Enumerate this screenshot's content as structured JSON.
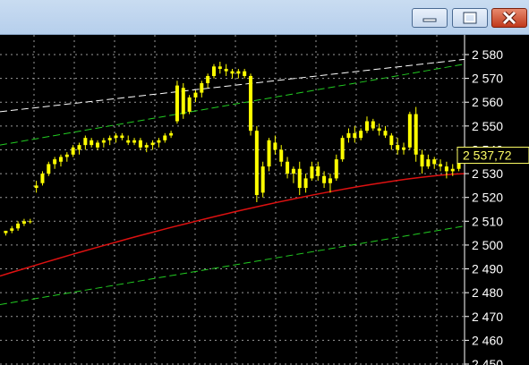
{
  "window": {
    "buttons": {
      "minimize_icon": "minimize-icon",
      "maximize_icon": "maximize-icon",
      "close_icon": "close-icon"
    }
  },
  "chart_data": {
    "type": "candlestick",
    "yaxis": {
      "ylim": [
        2447,
        2585
      ],
      "ticks": [
        2580,
        2570,
        2560,
        2550,
        2540,
        2530,
        2520,
        2510,
        2500,
        2490,
        2480,
        2470,
        2460,
        2450
      ],
      "tick_labels": [
        "2 580",
        "2 570",
        "2 560",
        "2 550",
        "2 540",
        "2 530",
        "2 520",
        "2 510",
        "2 500",
        "2 490",
        "2 480",
        "2 470",
        "2 460",
        "2 450"
      ]
    },
    "last_price_label": "2 537,72",
    "last_price": 2537.72,
    "grid": true,
    "candles": [
      [
        2505,
        2506,
        2504,
        2506
      ],
      [
        2506,
        2508,
        2505,
        2507
      ],
      [
        2507,
        2510,
        2506,
        2509
      ],
      [
        2509,
        2511,
        2508,
        2510
      ],
      [
        2510,
        2511,
        2509,
        2510
      ],
      [
        2524,
        2527,
        2522,
        2525
      ],
      [
        2526,
        2531,
        2525,
        2530
      ],
      [
        2530,
        2535,
        2529,
        2534
      ],
      [
        2534,
        2537,
        2532,
        2536
      ],
      [
        2535,
        2538,
        2533,
        2537
      ],
      [
        2537,
        2539,
        2535,
        2538
      ],
      [
        2538,
        2542,
        2537,
        2541
      ],
      [
        2540,
        2543,
        2538,
        2542
      ],
      [
        2542,
        2546,
        2540,
        2545
      ],
      [
        2544,
        2545,
        2541,
        2542
      ],
      [
        2541,
        2544,
        2540,
        2543
      ],
      [
        2543,
        2545,
        2541,
        2544
      ],
      [
        2544,
        2546,
        2542,
        2545
      ],
      [
        2545,
        2547,
        2543,
        2546
      ],
      [
        2546,
        2547,
        2544,
        2545
      ],
      [
        2544,
        2546,
        2542,
        2543
      ],
      [
        2543,
        2545,
        2542,
        2544
      ],
      [
        2544,
        2545,
        2540,
        2541
      ],
      [
        2541,
        2543,
        2539,
        2542
      ],
      [
        2542,
        2544,
        2540,
        2543
      ],
      [
        2543,
        2545,
        2541,
        2544
      ],
      [
        2544,
        2547,
        2543,
        2546
      ],
      [
        2546,
        2548,
        2545,
        2547
      ],
      [
        2552,
        2569,
        2551,
        2567
      ],
      [
        2566,
        2568,
        2553,
        2555
      ],
      [
        2556,
        2563,
        2555,
        2562
      ],
      [
        2562,
        2565,
        2560,
        2564
      ],
      [
        2564,
        2569,
        2562,
        2568
      ],
      [
        2568,
        2572,
        2566,
        2571
      ],
      [
        2571,
        2576,
        2570,
        2575
      ],
      [
        2575,
        2577,
        2572,
        2574
      ],
      [
        2574,
        2576,
        2571,
        2573
      ],
      [
        2573,
        2574,
        2570,
        2572
      ],
      [
        2572,
        2574,
        2570,
        2573
      ],
      [
        2573,
        2574,
        2570,
        2571
      ],
      [
        2571,
        2572,
        2546,
        2548
      ],
      [
        2548,
        2550,
        2518,
        2521
      ],
      [
        2522,
        2535,
        2520,
        2533
      ],
      [
        2533,
        2545,
        2531,
        2544
      ],
      [
        2543,
        2546,
        2538,
        2540
      ],
      [
        2540,
        2542,
        2533,
        2535
      ],
      [
        2535,
        2537,
        2528,
        2530
      ],
      [
        2530,
        2533,
        2526,
        2532
      ],
      [
        2532,
        2535,
        2521,
        2524
      ],
      [
        2524,
        2530,
        2522,
        2528
      ],
      [
        2528,
        2535,
        2527,
        2533
      ],
      [
        2533,
        2535,
        2527,
        2529
      ],
      [
        2529,
        2531,
        2524,
        2526
      ],
      [
        2526,
        2530,
        2522,
        2528
      ],
      [
        2528,
        2538,
        2527,
        2536
      ],
      [
        2536,
        2546,
        2535,
        2545
      ],
      [
        2545,
        2549,
        2543,
        2547
      ],
      [
        2547,
        2550,
        2543,
        2545
      ],
      [
        2545,
        2549,
        2544,
        2548
      ],
      [
        2548,
        2554,
        2547,
        2552
      ],
      [
        2552,
        2553,
        2548,
        2549
      ],
      [
        2549,
        2551,
        2546,
        2548
      ],
      [
        2548,
        2550,
        2545,
        2546
      ],
      [
        2546,
        2547,
        2540,
        2542
      ],
      [
        2542,
        2545,
        2538,
        2540
      ],
      [
        2540,
        2543,
        2538,
        2541
      ],
      [
        2541,
        2556,
        2540,
        2555
      ],
      [
        2555,
        2558,
        2535,
        2538
      ],
      [
        2538,
        2540,
        2530,
        2533
      ],
      [
        2533,
        2538,
        2532,
        2536
      ],
      [
        2536,
        2537,
        2532,
        2534
      ],
      [
        2534,
        2536,
        2531,
        2533
      ],
      [
        2533,
        2535,
        2528,
        2531
      ],
      [
        2531,
        2534,
        2529,
        2532
      ],
      [
        2532,
        2538,
        2531,
        2537
      ]
    ],
    "moving_average": {
      "color": "#dd1111",
      "start": 2487,
      "end": 2530
    },
    "trendlines": [
      {
        "color": "#ffffff",
        "from": 2556,
        "to": 2578,
        "dashed": true
      },
      {
        "color": "#22cc22",
        "from": 2542,
        "to": 2576,
        "dashed": true
      },
      {
        "color": "#22cc22",
        "from": 2475,
        "to": 2508,
        "dashed": true
      }
    ]
  }
}
